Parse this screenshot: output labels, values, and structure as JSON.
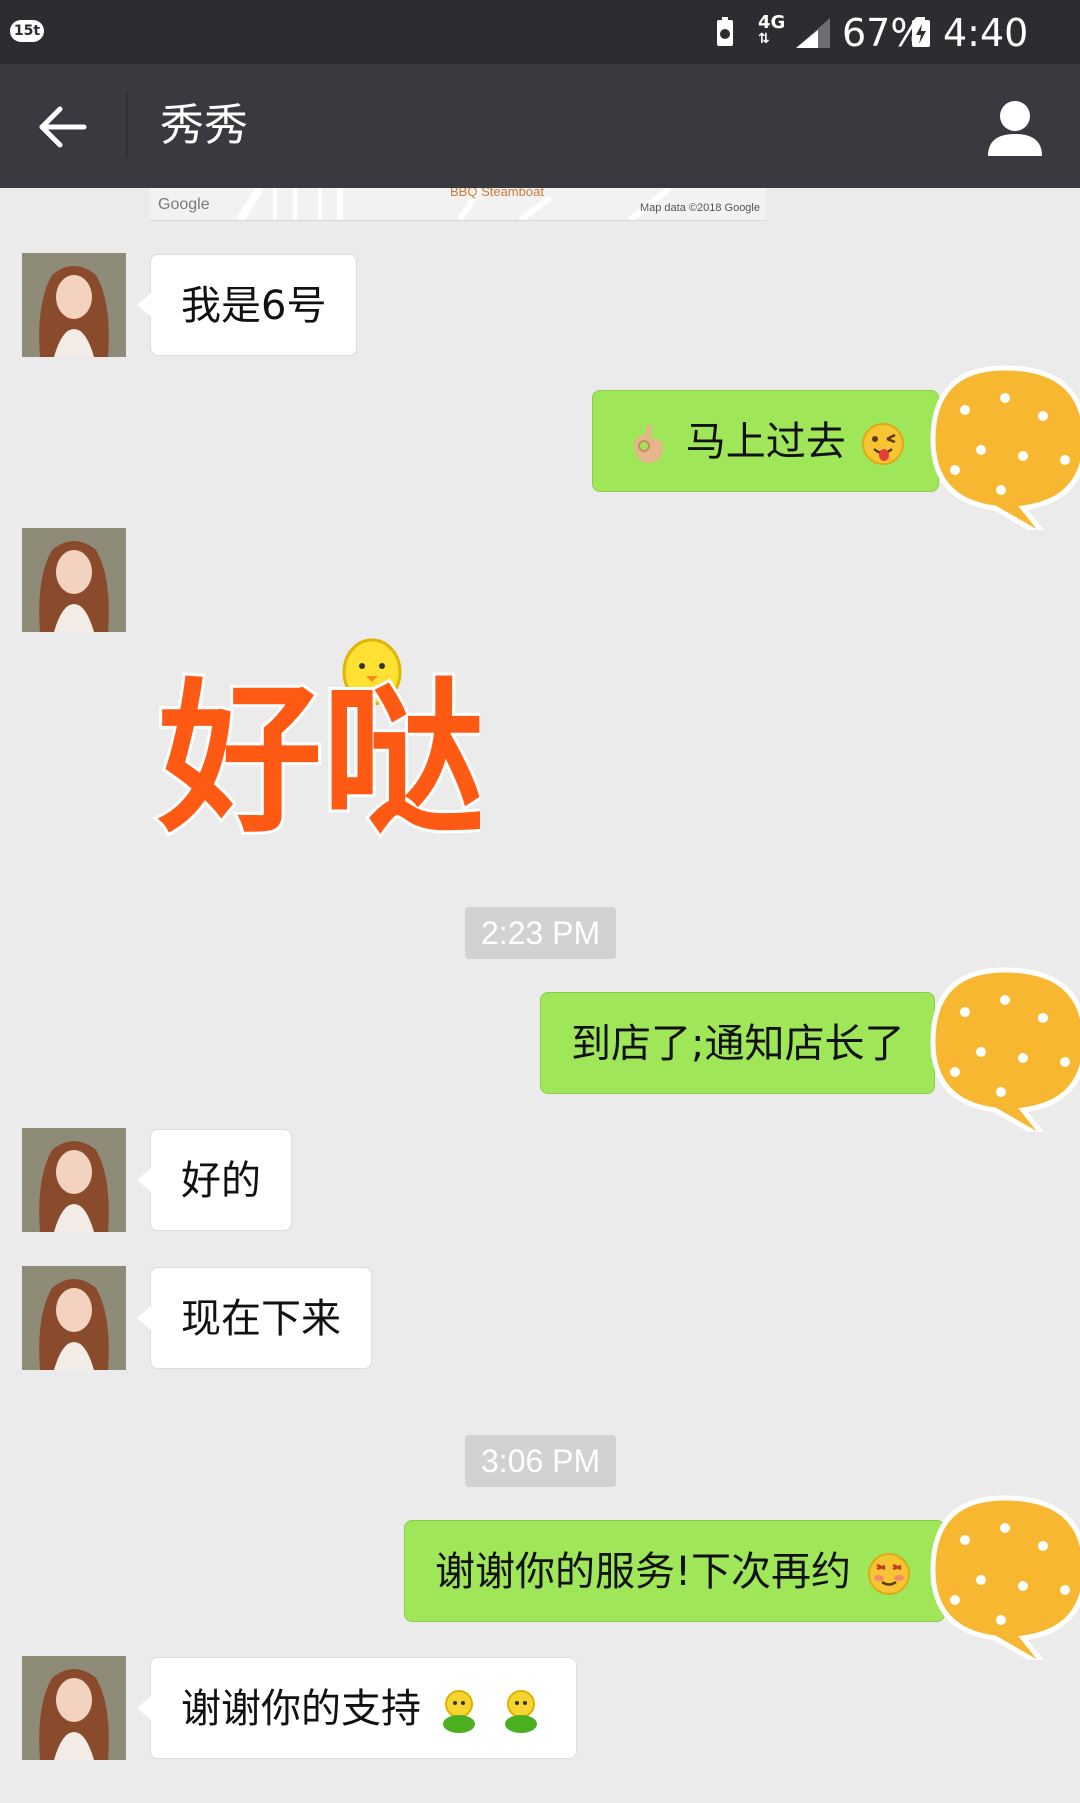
{
  "status_bar": {
    "app_badge": "15t",
    "network": "4G",
    "battery_percent": "67%",
    "time": "4:40 pm"
  },
  "header": {
    "title": "秀秀"
  },
  "map": {
    "google": "Google",
    "label": "BBQ Steamboat",
    "credit": "Map data ©2018 Google"
  },
  "messages": [
    {
      "side": "left",
      "text": "我是6号"
    },
    {
      "side": "right",
      "text": "马上过去",
      "emoji": [
        "ok-hand-emoji",
        "winking-tongue-emoji"
      ]
    },
    {
      "side": "left",
      "type": "sticker",
      "sticker_text": "好哒"
    },
    {
      "type": "timestamp",
      "text": "2:23 PM"
    },
    {
      "side": "right",
      "text": "到店了;通知店长了"
    },
    {
      "side": "left",
      "text": "好的"
    },
    {
      "side": "left",
      "text": "现在下来"
    },
    {
      "type": "timestamp",
      "text": "3:06 PM"
    },
    {
      "side": "right",
      "text": "谢谢你的服务!下次再约",
      "emoji": [
        "blushing-emoji"
      ]
    },
    {
      "side": "left",
      "text": "谢谢你的支持",
      "emoji": [
        "green-figure-emoji",
        "green-figure-emoji"
      ]
    }
  ],
  "colors": {
    "status_bar": "#2c2d30",
    "header": "#393a3f",
    "background": "#ebebeb",
    "sent_bubble": "#9fe658",
    "received_bubble": "#ffffff",
    "timestamp_bg": "#d2d2d2"
  }
}
